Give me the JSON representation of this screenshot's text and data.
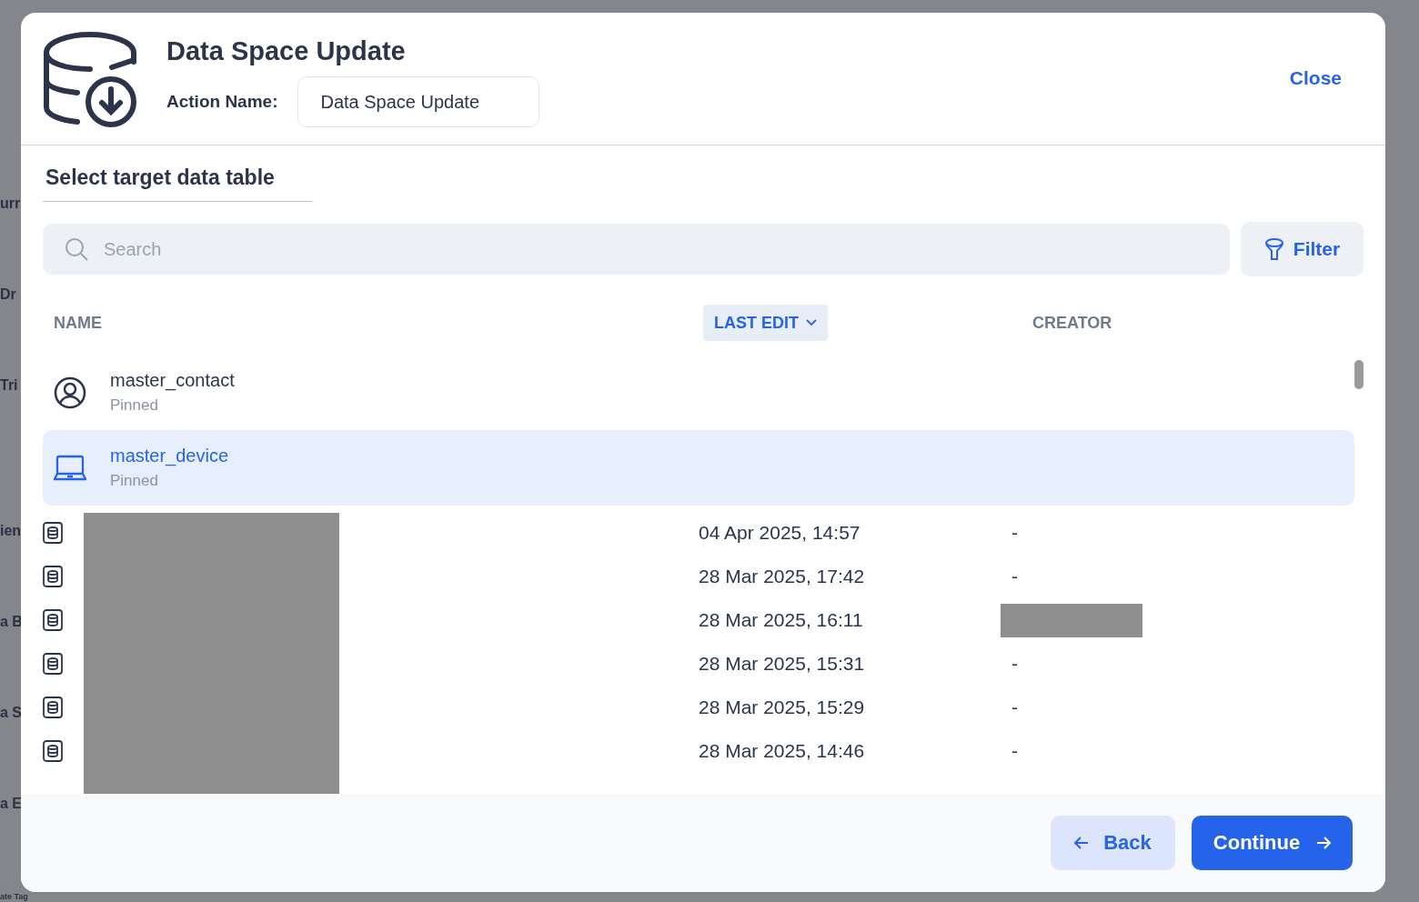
{
  "background": {
    "fragments": [
      "urr",
      "Dr",
      "Tri",
      "ien",
      "a B",
      "a S",
      "a E",
      "ate Tag"
    ]
  },
  "modal": {
    "title": "Data Space Update",
    "action_name_label": "Action Name:",
    "action_name_value": "Data Space Update",
    "close": "Close"
  },
  "section_tab": "Select target data table",
  "search": {
    "placeholder": "Search"
  },
  "filter_button": "Filter",
  "table": {
    "columns": [
      {
        "label": "NAME",
        "sorted": false
      },
      {
        "label": "LAST EDIT",
        "sorted": true
      },
      {
        "label": "CREATOR",
        "sorted": false
      }
    ],
    "pinned": [
      {
        "kind": "contact",
        "name": "master_contact",
        "note": "Pinned",
        "selected": false
      },
      {
        "kind": "device",
        "name": "master_device",
        "note": "Pinned",
        "selected": true
      }
    ],
    "names_redacted": true,
    "rows": [
      {
        "last_edit": "04 Apr 2025, 14:57",
        "creator": "-",
        "creator_redacted": false
      },
      {
        "last_edit": "28 Mar 2025, 17:42",
        "creator": "-",
        "creator_redacted": false
      },
      {
        "last_edit": "28 Mar 2025, 16:11",
        "creator": "",
        "creator_redacted": true
      },
      {
        "last_edit": "28 Mar 2025, 15:31",
        "creator": "-",
        "creator_redacted": false
      },
      {
        "last_edit": "28 Mar 2025, 15:29",
        "creator": "-",
        "creator_redacted": false
      },
      {
        "last_edit": "28 Mar 2025, 14:46",
        "creator": "-",
        "creator_redacted": false
      }
    ]
  },
  "footer": {
    "back": "Back",
    "continue": "Continue"
  }
}
